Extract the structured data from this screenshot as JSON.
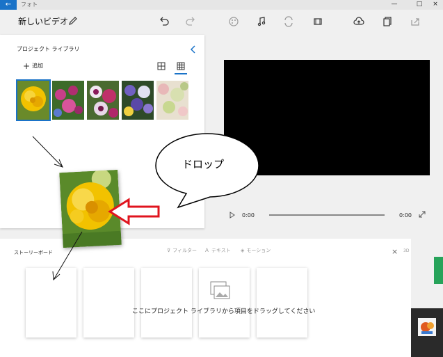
{
  "titlebar": {
    "back_icon": "back-arrow-icon",
    "app_name": "フォト",
    "minimize": "—",
    "maximize": "□",
    "close": "×"
  },
  "toolbar": {
    "video_title": "新しいビデオ",
    "icons": [
      "pencil-icon",
      "undo-icon",
      "redo-icon",
      "palette-icon",
      "music-icon",
      "sync-icon",
      "aspect-ratio-icon",
      "cloud-upload-icon",
      "copy-icon",
      "export-icon"
    ]
  },
  "library": {
    "title": "プロジェクト ライブラリ",
    "add_label": "追加",
    "thumbnails": [
      {
        "name": "yellow-flower",
        "color": "#e8b400"
      },
      {
        "name": "pink-flowers",
        "color": "#c0306a"
      },
      {
        "name": "pansies",
        "color": "#a0306a"
      },
      {
        "name": "violet-flowers",
        "color": "#5a4aa0"
      },
      {
        "name": "blossoms",
        "color": "#d8c8a0"
      }
    ]
  },
  "preview": {
    "current_time": "0:00",
    "total_time": "0:00"
  },
  "storyboard": {
    "title": "ストーリーボード",
    "filters_label": "フィルター",
    "text_label": "テキスト",
    "motion_label": "モーション",
    "rest_label": "3D",
    "drag_hint": "ここにプロジェクト ライブラリから項目をドラッグしてください"
  },
  "annotation": {
    "bubble_text": "ドロップ",
    "arrow_color": "#e0141e"
  }
}
